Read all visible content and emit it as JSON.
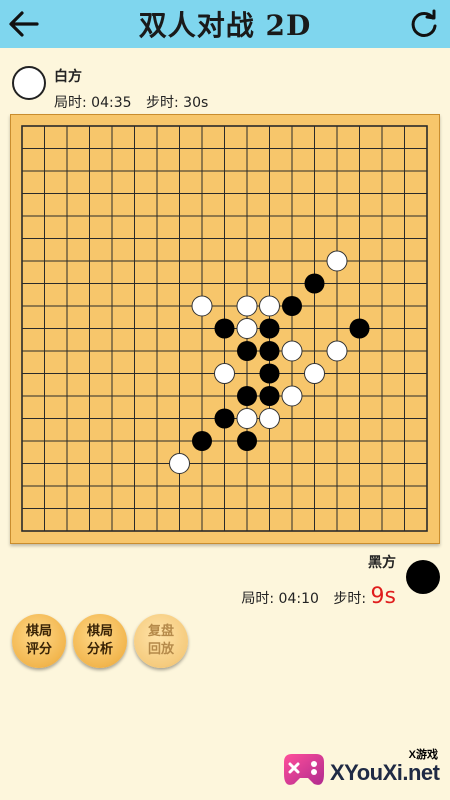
{
  "header": {
    "title": "双人对战 2D",
    "back_icon": "back-arrow-icon",
    "refresh_icon": "refresh-icon",
    "background": "#7fd6ee"
  },
  "white_player": {
    "name": "白方",
    "game_time_label": "局时:",
    "game_time": "04:35",
    "step_time_label": "步时:",
    "step_time": "30s"
  },
  "black_player": {
    "name": "黑方",
    "game_time_label": "局时:",
    "game_time": "04:10",
    "step_time_label": "步时:",
    "step_time": "9s",
    "step_time_color": "#e01d1d"
  },
  "board": {
    "size": 19,
    "stones": [
      {
        "color": "white",
        "col": 14,
        "row": 6
      },
      {
        "color": "black",
        "col": 13,
        "row": 7
      },
      {
        "color": "black",
        "col": 12,
        "row": 8
      },
      {
        "color": "white",
        "col": 8,
        "row": 8
      },
      {
        "color": "white",
        "col": 10,
        "row": 8
      },
      {
        "color": "white",
        "col": 11,
        "row": 8
      },
      {
        "color": "black",
        "col": 9,
        "row": 9
      },
      {
        "color": "white",
        "col": 10,
        "row": 9
      },
      {
        "color": "black",
        "col": 11,
        "row": 9
      },
      {
        "color": "black",
        "col": 15,
        "row": 9
      },
      {
        "color": "black",
        "col": 10,
        "row": 10
      },
      {
        "color": "black",
        "col": 11,
        "row": 10
      },
      {
        "color": "white",
        "col": 12,
        "row": 10
      },
      {
        "color": "white",
        "col": 14,
        "row": 10
      },
      {
        "color": "white",
        "col": 9,
        "row": 11
      },
      {
        "color": "black",
        "col": 11,
        "row": 11
      },
      {
        "color": "white",
        "col": 13,
        "row": 11
      },
      {
        "color": "black",
        "col": 10,
        "row": 12
      },
      {
        "color": "black",
        "col": 11,
        "row": 12
      },
      {
        "color": "white",
        "col": 12,
        "row": 12
      },
      {
        "color": "black",
        "col": 9,
        "row": 13
      },
      {
        "color": "white",
        "col": 10,
        "row": 13
      },
      {
        "color": "white",
        "col": 11,
        "row": 13
      },
      {
        "color": "black",
        "col": 8,
        "row": 14
      },
      {
        "color": "black",
        "col": 10,
        "row": 14
      },
      {
        "color": "white",
        "col": 7,
        "row": 15
      }
    ]
  },
  "tools": [
    {
      "line1": "棋局",
      "line2": "评分",
      "enabled": true
    },
    {
      "line1": "棋局",
      "line2": "分析",
      "enabled": true
    },
    {
      "line1": "复盘",
      "line2": "回放",
      "enabled": false
    }
  ],
  "watermark": {
    "badge": "X游戏",
    "text": "XYouXi.net"
  }
}
